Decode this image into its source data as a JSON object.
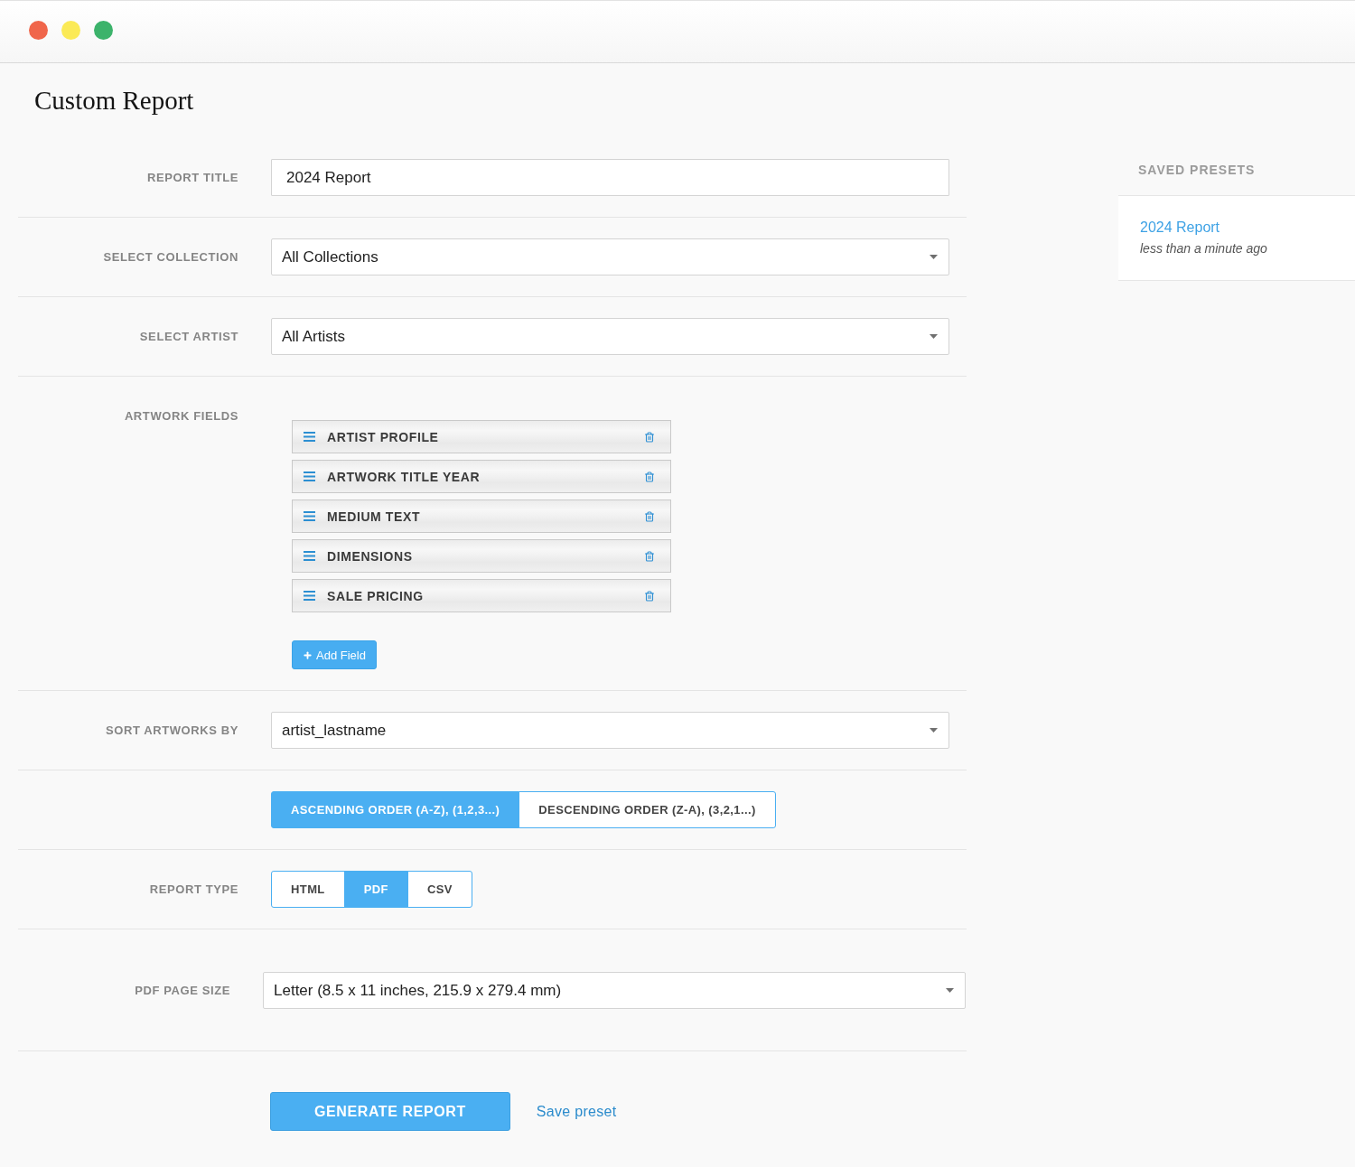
{
  "window": {
    "controls": [
      {
        "color": "#f0664b"
      },
      {
        "color": "#fbea56"
      },
      {
        "color": "#3cb36b"
      }
    ]
  },
  "page": {
    "title": "Custom Report"
  },
  "form": {
    "rows": [
      {
        "kind": "text",
        "label": "REPORT TITLE",
        "value": "2024 Report"
      },
      {
        "kind": "select",
        "label": "SELECT COLLECTION",
        "value": "All Collections"
      },
      {
        "kind": "select",
        "label": "SELECT ARTIST",
        "value": "All Artists"
      },
      {
        "kind": "fields",
        "label": "ARTWORK FIELDS",
        "items": [
          "ARTIST PROFILE",
          "ARTWORK TITLE YEAR",
          "MEDIUM TEXT",
          "DIMENSIONS",
          "SALE PRICING"
        ],
        "add_button": "Add Field"
      },
      {
        "kind": "select",
        "label": "SORT ARTWORKS BY",
        "value": "artist_lastname"
      },
      {
        "kind": "toggle",
        "options": [
          {
            "label": "ASCENDING ORDER (A-Z), (1,2,3...)",
            "selected": true
          },
          {
            "label": "DESCENDING ORDER (Z-A), (3,2,1...)",
            "selected": false
          }
        ]
      },
      {
        "kind": "toggle",
        "label": "REPORT TYPE",
        "options": [
          {
            "label": "HTML",
            "selected": false
          },
          {
            "label": "PDF",
            "selected": true
          },
          {
            "label": "CSV",
            "selected": false
          }
        ]
      },
      {
        "kind": "select",
        "label": "PDF PAGE SIZE",
        "value": "Letter (8.5 x 11 inches, 215.9 x 279.4 mm)"
      }
    ],
    "actions": {
      "generate_button": "GENERATE REPORT",
      "save_link": "Save preset"
    }
  },
  "saved_presets": {
    "heading": "SAVED PRESETS",
    "items": [
      {
        "name": "2024 Report",
        "time": "less than a minute ago"
      }
    ]
  }
}
